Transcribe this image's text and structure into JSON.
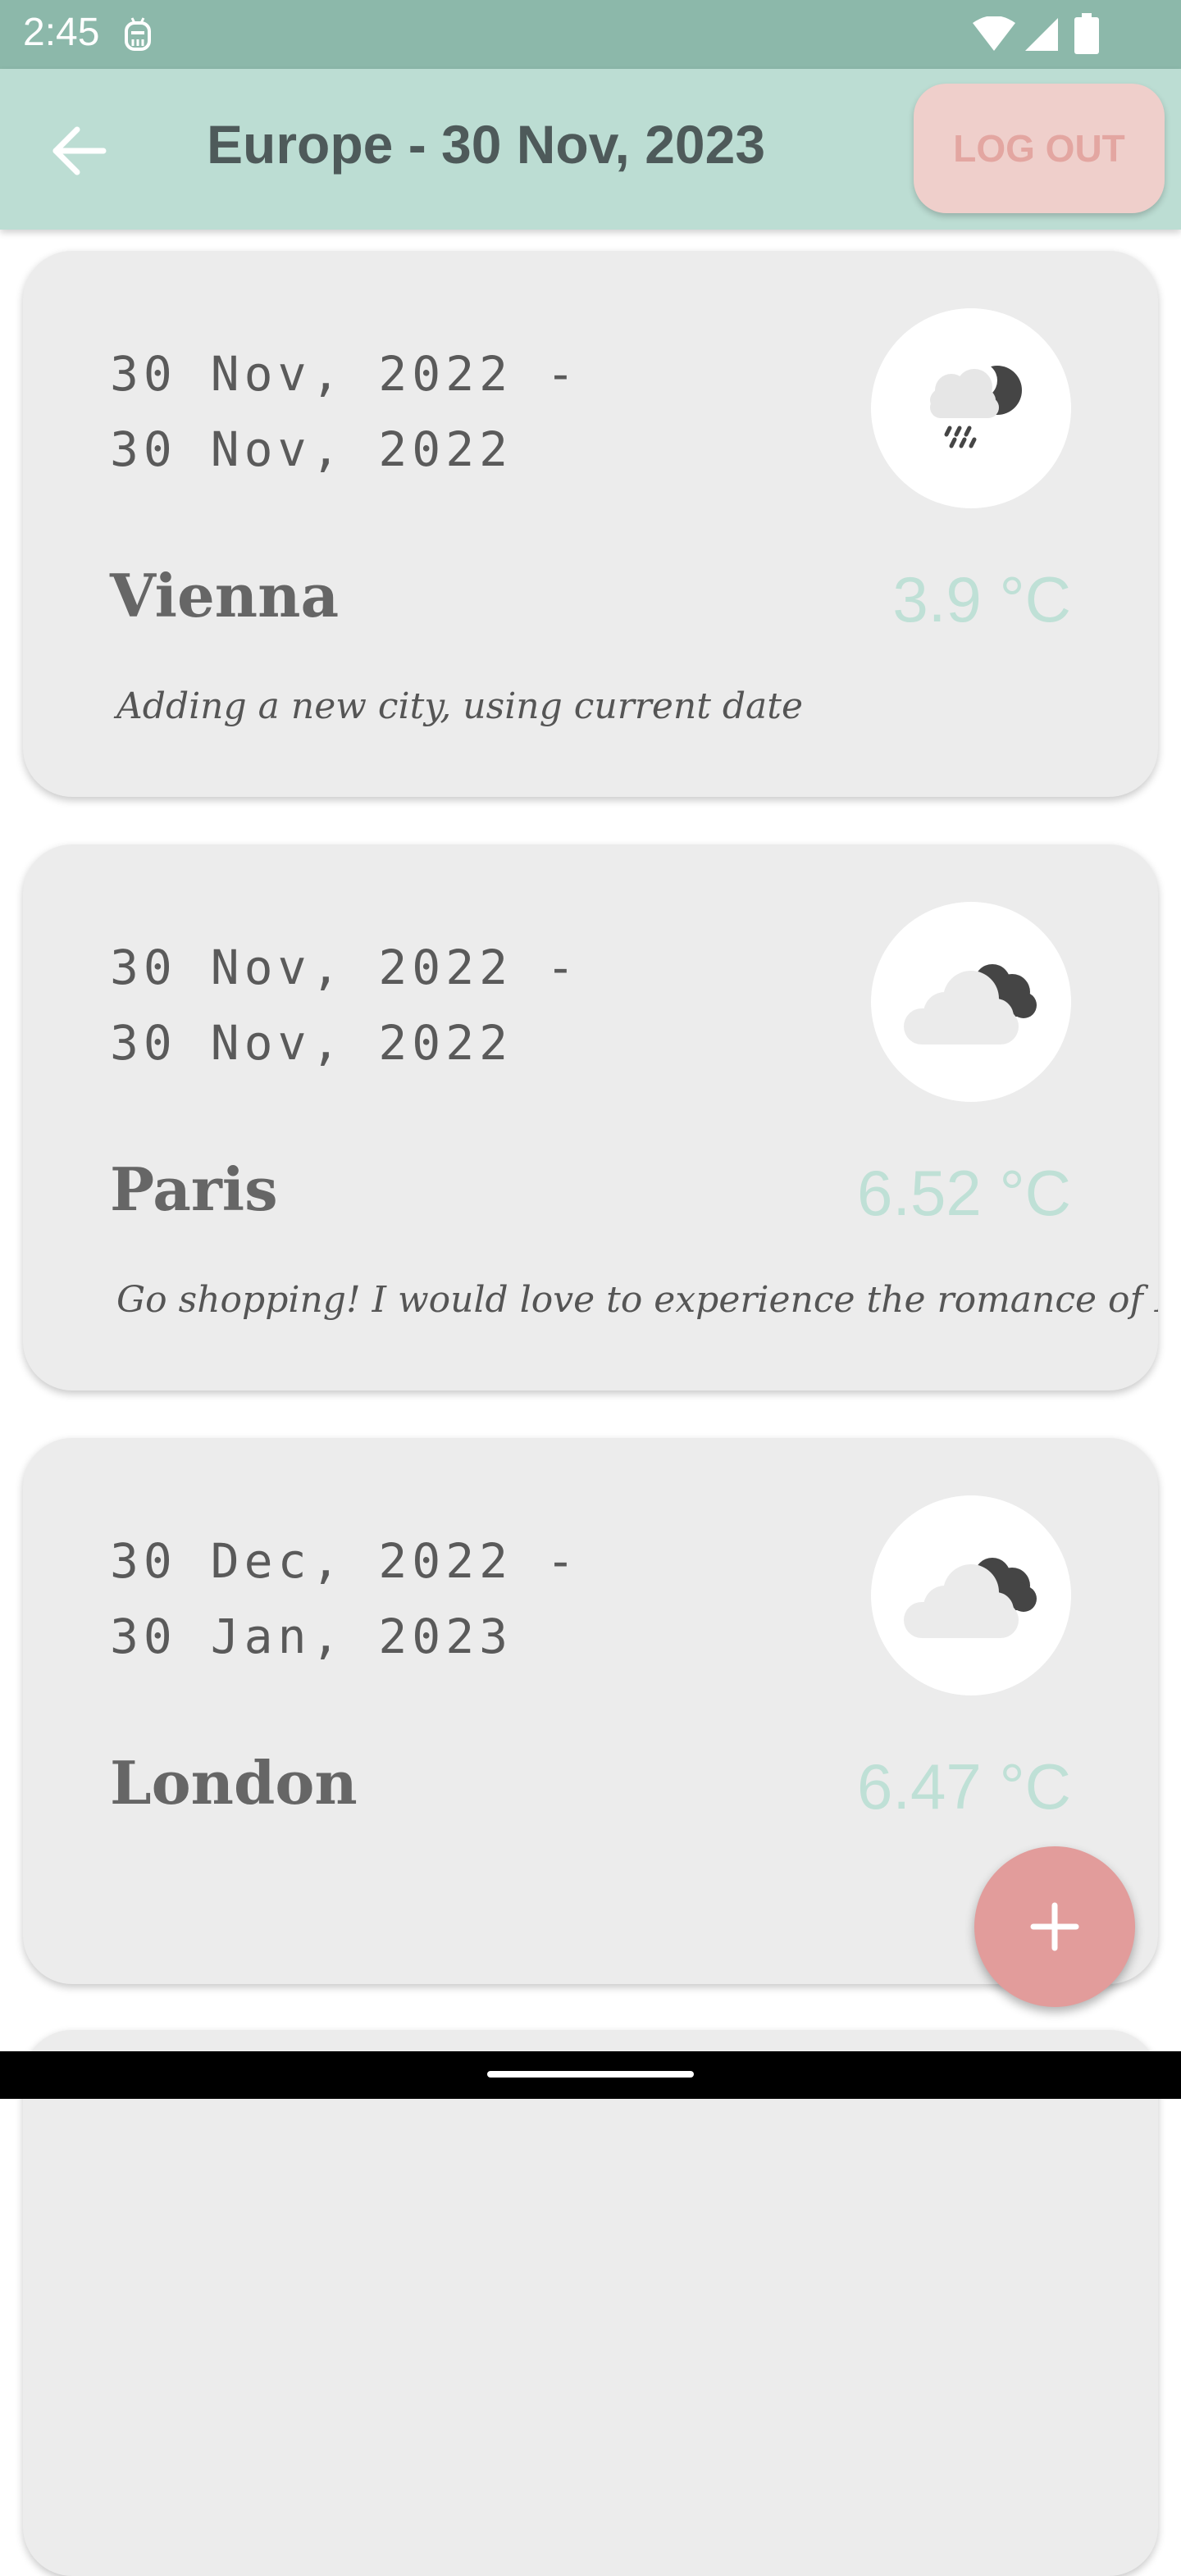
{
  "status_bar": {
    "time": "2:45"
  },
  "app_bar": {
    "title": "Europe - 30 Nov, 2023",
    "logout_label": "LOG OUT"
  },
  "trips": [
    {
      "date_start": "30 Nov, 2022 -",
      "date_end": "30 Nov, 2022",
      "city": "Vienna",
      "temperature": "3.9 °C",
      "note": "Adding a new city, using current date",
      "weather_icon": "rain-night-icon"
    },
    {
      "date_start": "30 Nov, 2022 -",
      "date_end": "30 Nov, 2022",
      "city": "Paris",
      "temperature": "6.52 °C",
      "note": "Go shopping! I would love to experience the romance of France!",
      "weather_icon": "cloudy-night-icon"
    },
    {
      "date_start": "30 Dec, 2022 -",
      "date_end": "30 Jan, 2023",
      "city": "London",
      "temperature": "6.47 °C",
      "note": "",
      "weather_icon": "cloudy-night-icon"
    }
  ],
  "colors": {
    "status_bar": "#8cb8aa",
    "app_bar": "#bcddd3",
    "logout_bg": "#efcfcb",
    "logout_text": "#e3a6a1",
    "temperature": "#bfe0d6",
    "fab": "#e29c9b",
    "card": "#ececec"
  }
}
